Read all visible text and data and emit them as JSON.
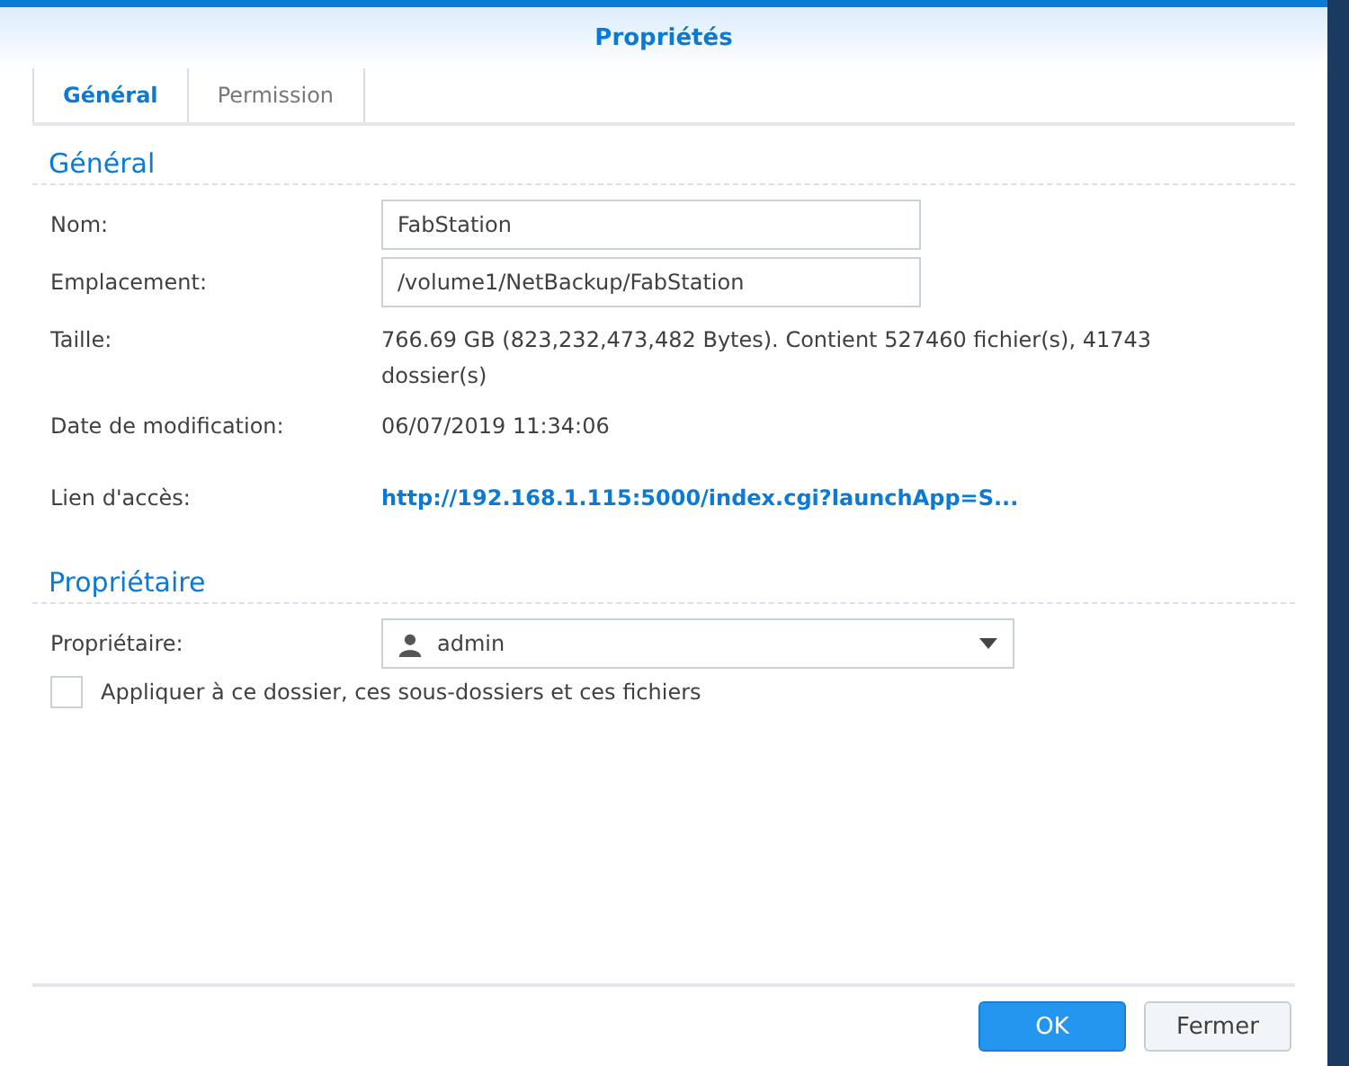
{
  "window": {
    "title": "Propriétés"
  },
  "tabs": [
    {
      "label": "Général",
      "selected": true
    },
    {
      "label": "Permission",
      "selected": false
    }
  ],
  "sections": [
    {
      "title": "Général",
      "rows": [
        {
          "kind": "field",
          "label": "Nom:",
          "value": "FabStation"
        },
        {
          "kind": "field",
          "label": "Emplacement:",
          "value": "/volume1/NetBackup/FabStation"
        },
        {
          "kind": "text",
          "label": "Taille:",
          "value": "766.69 GB (823,232,473,482 Bytes). Contient 527460 fichier(s), 41743 dossier(s)"
        },
        {
          "kind": "text",
          "label": "Date de modification:",
          "value": "06/07/2019 11:34:06"
        },
        {
          "kind": "link",
          "label": "Lien d'accès:",
          "value": "http://192.168.1.115:5000/index.cgi?launchApp=S..."
        }
      ]
    },
    {
      "title": "Propriétaire",
      "rows": [
        {
          "kind": "select",
          "label": "Propriétaire:",
          "value": "admin"
        }
      ]
    }
  ],
  "apply_checkbox": {
    "label": "Appliquer à ce dossier, ces sous-dossiers et ces fichiers",
    "checked": false
  },
  "buttons": [
    {
      "label": "OK",
      "kind": "primary"
    },
    {
      "label": "Fermer",
      "kind": "secondary"
    }
  ]
}
